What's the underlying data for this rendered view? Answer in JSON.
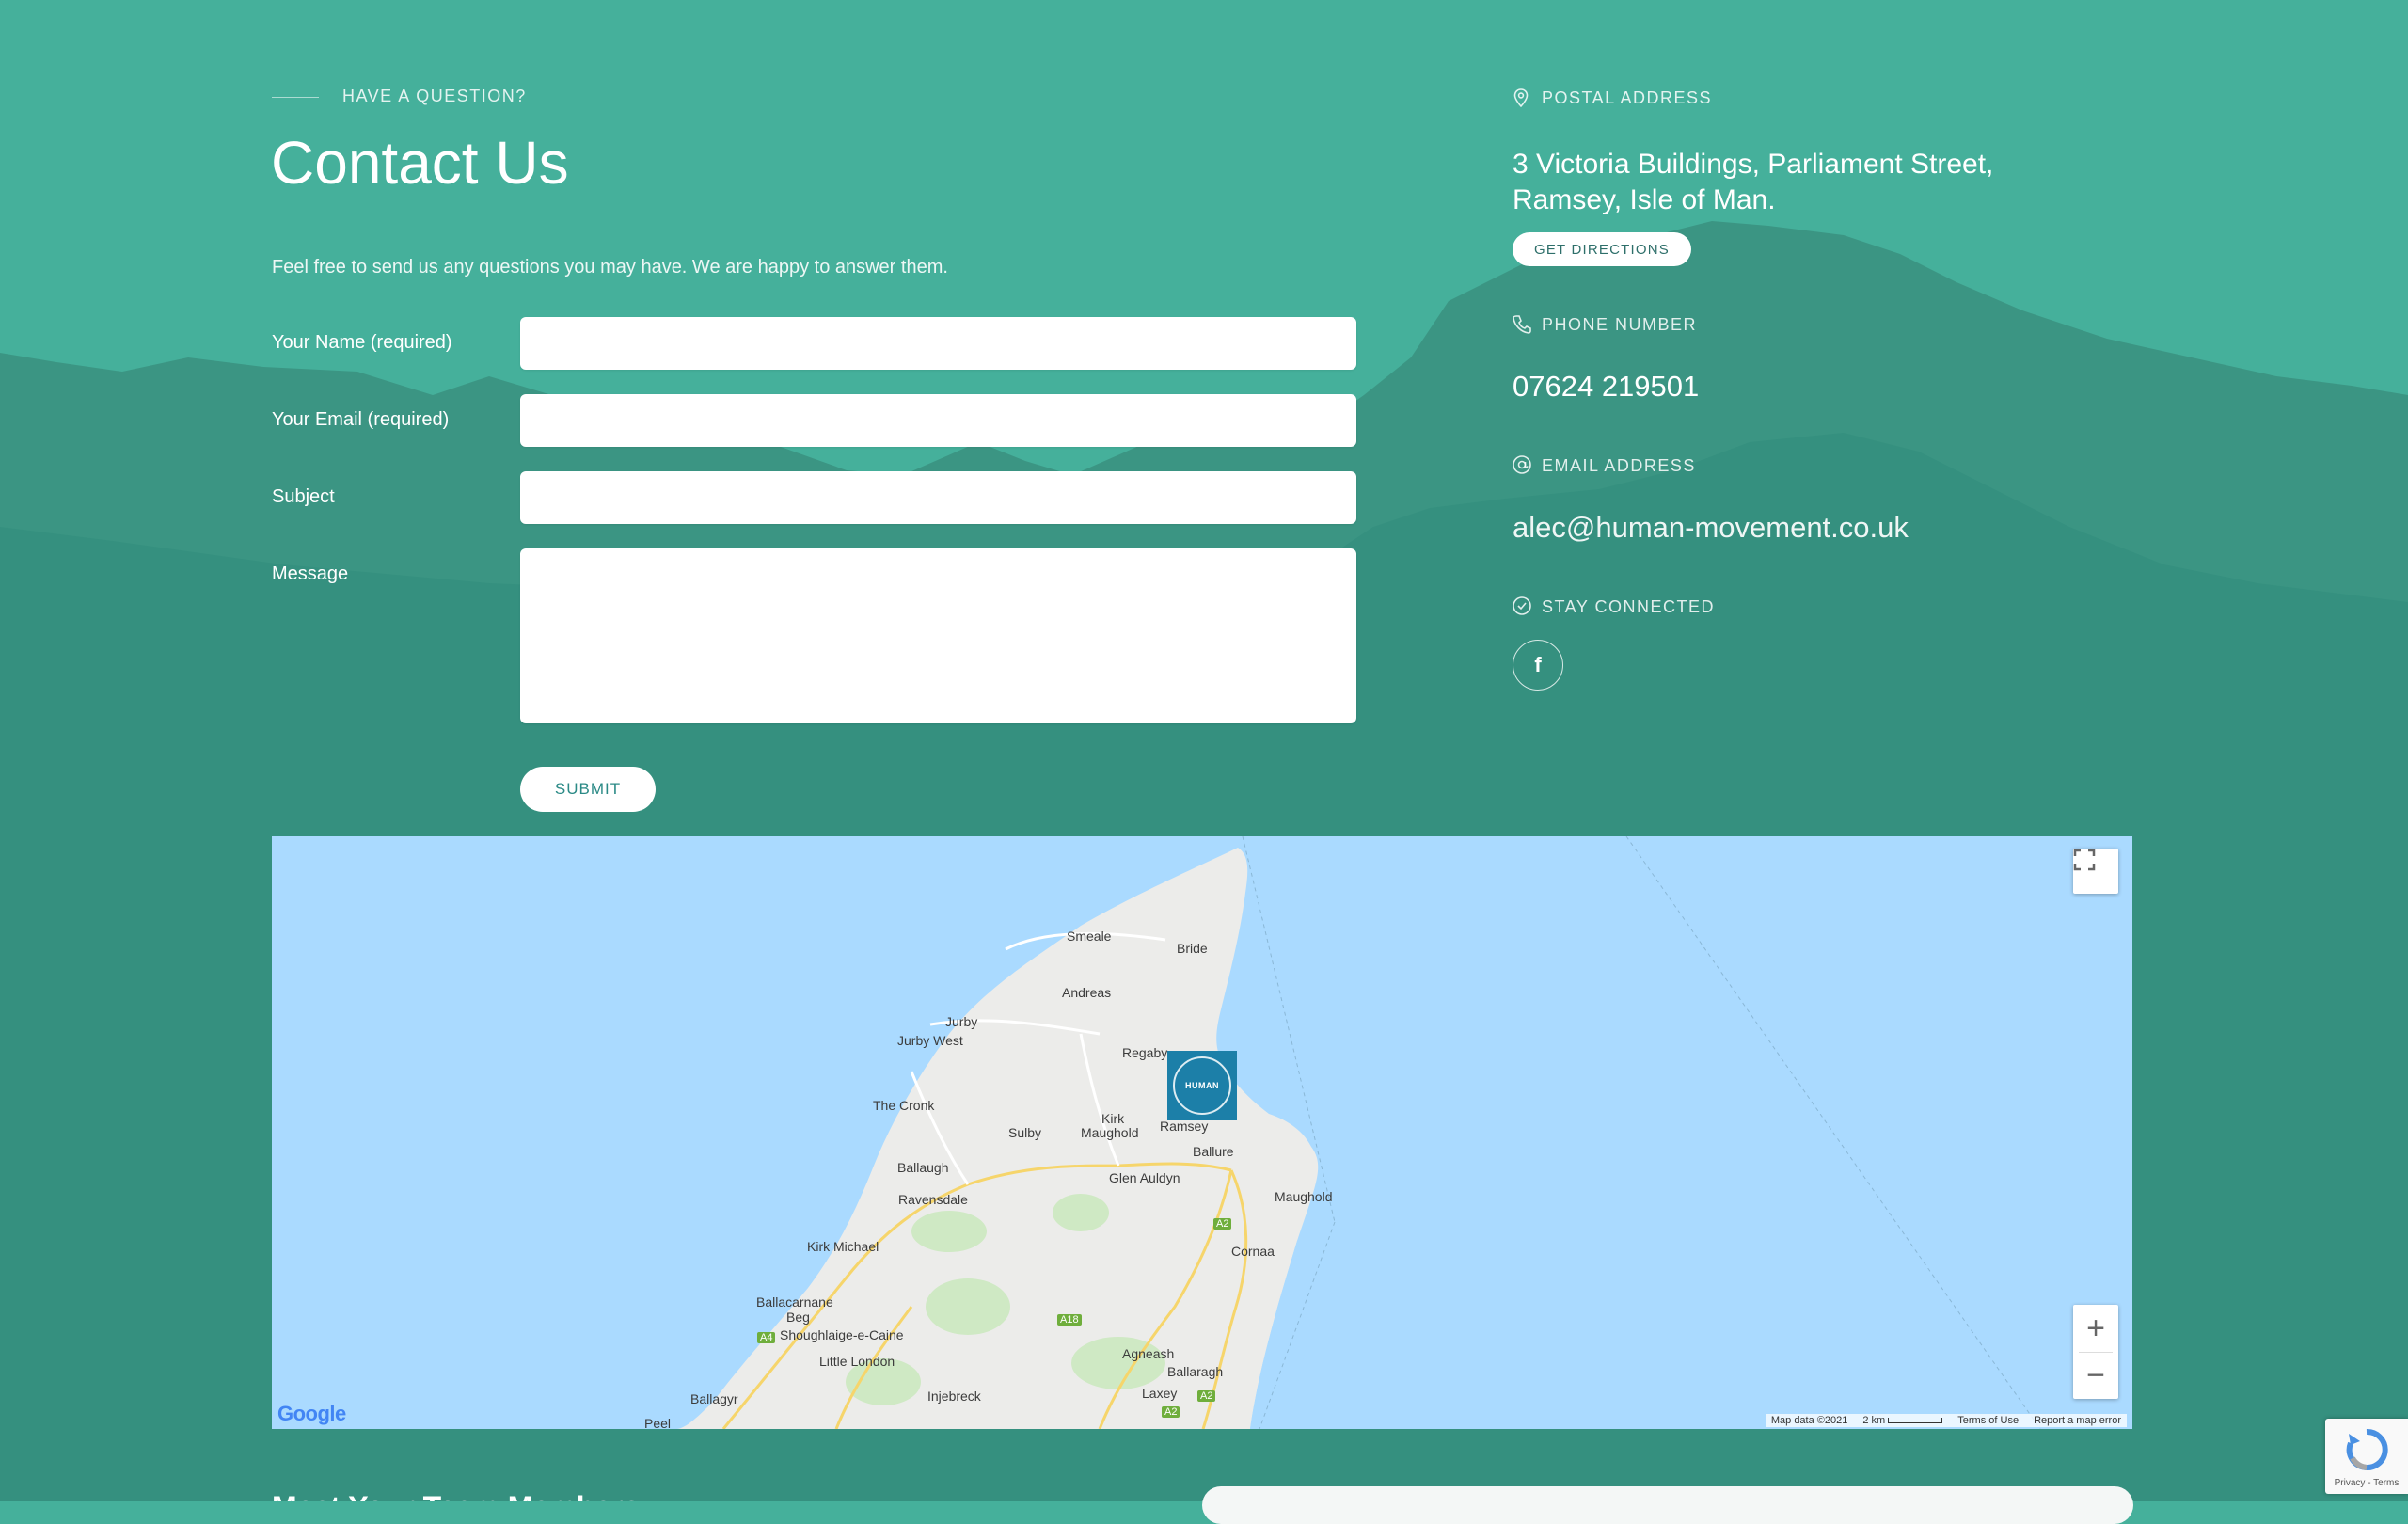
{
  "contact": {
    "eyebrow": "HAVE A QUESTION?",
    "title": "Contact Us",
    "intro": "Feel free to send us any questions you may have. We are happy to answer them."
  },
  "form": {
    "name_label": "Your Name (required)",
    "email_label": "Your Email (required)",
    "subject_label": "Subject",
    "message_label": "Message",
    "name_value": "",
    "email_value": "",
    "subject_value": "",
    "message_value": "",
    "submit_label": "SUBMIT"
  },
  "info": {
    "postal_heading": "POSTAL ADDRESS",
    "address_line1": "3 Victoria Buildings, Parliament Street,",
    "address_line2": "Ramsey, Isle of Man.",
    "directions_label": "GET DIRECTIONS",
    "phone_heading": "PHONE NUMBER",
    "phone": "07624 219501",
    "email_heading": "EMAIL ADDRESS",
    "email": "alec@human-movement.co.uk",
    "social_heading": "STAY CONNECTED",
    "facebook_glyph": "f"
  },
  "map": {
    "places": {
      "smeale": "Smeale",
      "bride": "Bride",
      "andreas": "Andreas",
      "jurby": "Jurby",
      "jurby_west": "Jurby West",
      "regaby": "Regaby",
      "the_cronk": "The Cronk",
      "kirk": "Kirk",
      "maughold_kirk": "Maughold",
      "ramsey": "Ramsey",
      "sulby": "Sulby",
      "ballure": "Ballure",
      "ballaugh": "Ballaugh",
      "glen_auldyn": "Glen Auldyn",
      "maughold": "Maughold",
      "ravensdale": "Ravensdale",
      "cornaa": "Cornaa",
      "kirk_michael": "Kirk Michael",
      "ballacarnane": "Ballacarnane",
      "beg": "Beg",
      "shoughlaige": "Shoughlaige-e-Caine",
      "agneash": "Agneash",
      "little_london": "Little London",
      "ballaragh": "Ballaragh",
      "laxey": "Laxey",
      "injebreck": "Injebreck",
      "ballagyr": "Ballagyr",
      "peel": "Peel"
    },
    "roads": {
      "a2_1": "A2",
      "a2_2": "A2",
      "a2_3": "A2",
      "a18": "A18",
      "a4": "A4"
    },
    "marker_label": "HUMAN",
    "zoom_in": "+",
    "zoom_out": "−",
    "logo": "Google",
    "attribution": {
      "data": "Map data ©2021",
      "scale": "2 km",
      "terms": "Terms of Use",
      "report": "Report a map error"
    }
  },
  "recaptcha": {
    "links": "Privacy - Terms"
  },
  "footer": {
    "partial_heading": "Meet Your Team Members"
  }
}
